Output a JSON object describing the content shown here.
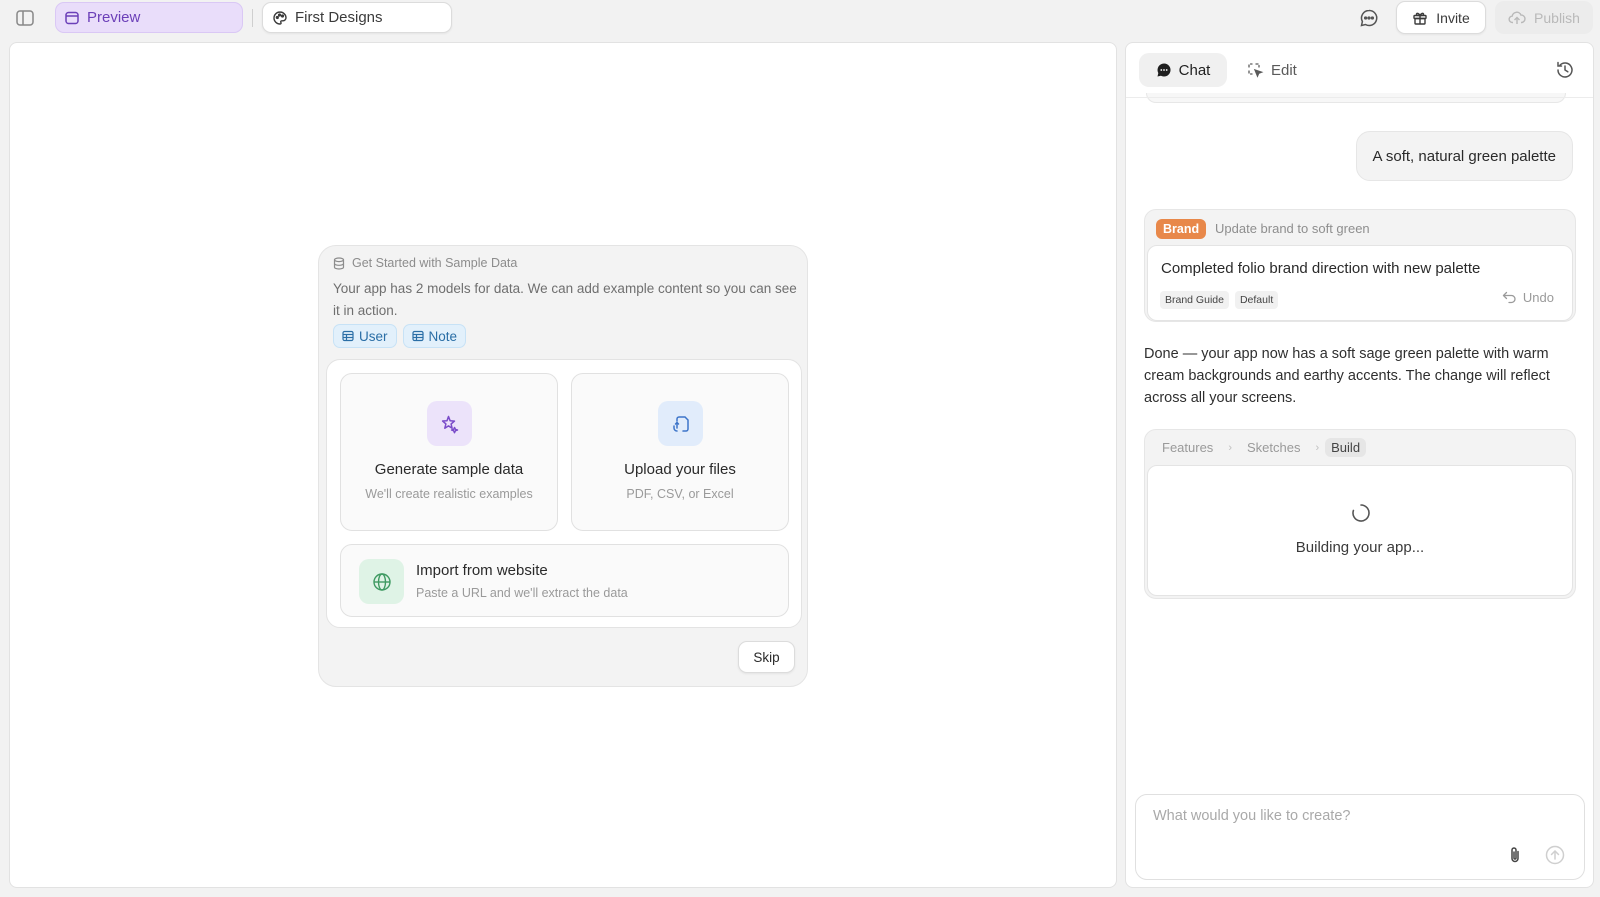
{
  "topbar": {
    "preview_label": "Preview",
    "project_name": "First Designs",
    "invite_label": "Invite",
    "publish_label": "Publish"
  },
  "sample_data": {
    "header": "Get Started with Sample Data",
    "description": "Your app has 2 models for data. We can add example content so you can see it in action.",
    "models": [
      "User",
      "Note"
    ],
    "options": [
      {
        "title": "Generate sample data",
        "subtitle": "We'll create realistic examples",
        "icon": "sparkle-icon"
      },
      {
        "title": "Upload your files",
        "subtitle": "PDF, CSV, or Excel",
        "icon": "upload-file-icon"
      }
    ],
    "import": {
      "title": "Import from website",
      "subtitle": "Paste a URL and we'll extract the data",
      "icon": "globe-icon"
    },
    "skip_label": "Skip"
  },
  "chat": {
    "tabs": {
      "chat": "Chat",
      "edit": "Edit"
    },
    "user_message": "A soft, natural green palette",
    "brand_update": {
      "tag": "Brand",
      "title": "Update brand to soft green",
      "summary": "Completed folio brand direction with new palette",
      "chips": [
        "Brand Guide",
        "Default"
      ],
      "undo_label": "Undo"
    },
    "assistant_message": "Done — your app now has a soft sage green palette with warm cream backgrounds and earthy accents. The change will reflect across all your screens.",
    "build": {
      "steps": [
        "Features",
        "Sketches",
        "Build"
      ],
      "active_step": "Build",
      "status": "Building your app..."
    },
    "composer": {
      "placeholder": "What would you like to create?"
    }
  },
  "colors": {
    "accent_purple": "#6b3fb8",
    "brand_orange": "#e8884a",
    "chip_blue": "#2a6ea6"
  }
}
